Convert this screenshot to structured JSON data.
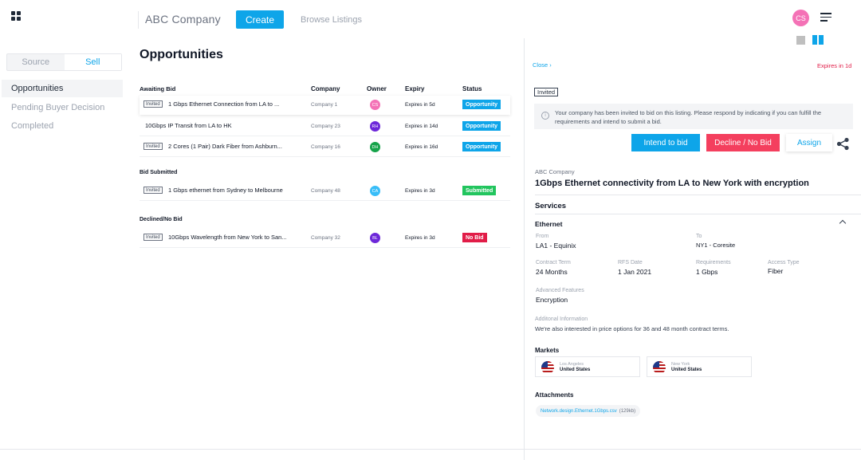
{
  "header": {
    "company": "ABC Company",
    "create_label": "Create",
    "browse_label": "Browse Listings",
    "user_initials": "CS"
  },
  "sidebar": {
    "toggle": {
      "source": "Source",
      "sell": "Sell"
    },
    "items": [
      {
        "label": "Opportunities"
      },
      {
        "label": "Pending Buyer Decision"
      },
      {
        "label": "Completed"
      }
    ]
  },
  "main": {
    "title": "Opportunities",
    "columns": {
      "company": "Company",
      "owner": "Owner",
      "expiry": "Expiry",
      "status": "Status"
    },
    "sections": [
      {
        "label": "Awaiting Bid",
        "rows": [
          {
            "badge": "Invited",
            "title": "1 Gbps Ethernet Connection from LA to ...",
            "company": "Company 1",
            "owner": "CS",
            "owner_color": "#f472b6",
            "expiry": "Expires in 5d",
            "status": "Opportunity",
            "status_color": "#0ea5e9"
          },
          {
            "badge": "",
            "title": "10Gbps IP Transit from LA to HK",
            "company": "Company 23",
            "owner": "RH",
            "owner_color": "#6d28d9",
            "expiry": "Expires in 14d",
            "status": "Opportunity",
            "status_color": "#0ea5e9"
          },
          {
            "badge": "Invited",
            "title": "2 Cores (1 Pair) Dark Fiber from Ashburn...",
            "company": "Company 16",
            "owner": "DH",
            "owner_color": "#16a34a",
            "expiry": "Expires in 16d",
            "status": "Opportunity",
            "status_color": "#0ea5e9"
          }
        ]
      },
      {
        "label": "Bid Submitted",
        "rows": [
          {
            "badge": "Invited",
            "title": "1 Gbps ethernet from Sydney to Melbourne",
            "company": "Company 48",
            "owner": "CA",
            "owner_color": "#38bdf8",
            "expiry": "Expires in 3d",
            "status": "Submitted",
            "status_color": "#22c55e"
          }
        ]
      },
      {
        "label": "Declined/No Bid",
        "rows": [
          {
            "badge": "Invited",
            "title": "10Gbps Wavelength from New York to San...",
            "company": "Company 32",
            "owner": "BL",
            "owner_color": "#6d28d9",
            "expiry": "Expires in 3d",
            "status": "No Bid",
            "status_color": "#e11d48"
          }
        ]
      }
    ]
  },
  "detail": {
    "close_label": "Close",
    "expires": "Expires in 1d",
    "invited_tag": "Invited",
    "info_text": "Your company has been invited to bid on this listing. Please respond by indicating if you can fulfill the requirements and intend to submit a bid.",
    "buttons": {
      "intend": "Intend to bid",
      "decline": "Decline / No Bid",
      "assign": "Assign"
    },
    "company": "ABC Company",
    "title": "1Gbps Ethernet connectivity from LA to New York with encryption",
    "services_label": "Services",
    "service_name": "Ethernet",
    "from_label": "From",
    "from_value": "LA1 - Equinix",
    "to_label": "To",
    "to_value": "NY1 - Coresite",
    "contract_label": "Contract Term",
    "contract_value": "24 Months",
    "rfs_label": "RFS Date",
    "rfs_value": "1 Jan 2021",
    "req_label": "Requirements",
    "req_value": "1 Gbps",
    "access_label": "Access Type",
    "access_value": "Fiber",
    "adv_label": "Advanced Features",
    "adv_value": "Encryption",
    "addl_label": "Additonal Information",
    "addl_value": "We're also interested in price options for 36 and 48 month contract terms.",
    "markets_label": "Markets",
    "markets": [
      {
        "city": "Los Angeles",
        "country": "United States"
      },
      {
        "city": "New York",
        "country": "United States"
      }
    ],
    "attachments_label": "Attachments",
    "attachment_file": "Network.design.Ethernet.1Gbps.csv",
    "attachment_size": "(129kb)"
  },
  "colors": {
    "accent": "#0ea5e9",
    "danger": "#f43f5e",
    "success": "#22c55e"
  }
}
